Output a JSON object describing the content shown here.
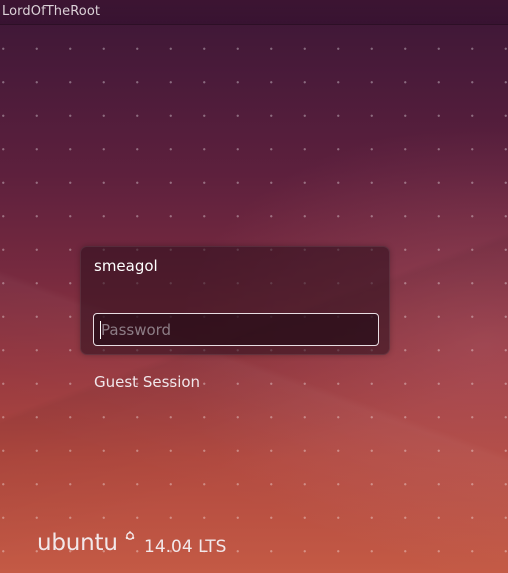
{
  "top_bar": {
    "hostname": "LordOfTheRoot"
  },
  "login": {
    "username": "smeagol",
    "password_value": "",
    "password_placeholder": "Password"
  },
  "sessions": {
    "guest_label": "Guest Session"
  },
  "branding": {
    "logo_text": "ubuntu",
    "version": "14.04 LTS",
    "logo_icon": "circle-of-friends-icon"
  },
  "colors": {
    "bg_top": "#3c1736",
    "bg_bottom": "#c45a45",
    "text": "#ffffff",
    "placeholder": "#8d7d86"
  }
}
